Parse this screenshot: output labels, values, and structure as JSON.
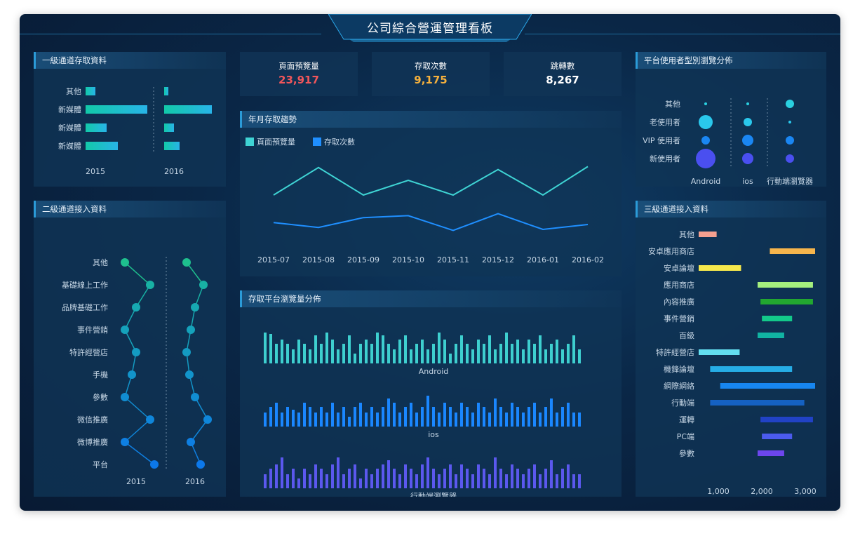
{
  "dashboard": {
    "title": "公司綜合營運管理看板"
  },
  "kpis": [
    {
      "label": "頁面預覽量",
      "value": "23,917",
      "color": "#f0565b"
    },
    {
      "label": "存取次數",
      "value": "9,175",
      "color": "#f6b13d"
    },
    {
      "label": "跳轉數",
      "value": "8,267",
      "color": "#ffffff"
    }
  ],
  "panels": {
    "level1": "一級通道存取資料",
    "level2": "二級通道接入資料",
    "trend": "年月存取趨勢",
    "platform": "存取平台瀏覽量分佈",
    "usertype": "平台使用者型別瀏覽分佈",
    "level3": "三級通道接入資料"
  },
  "chart_data": [
    {
      "type": "bar",
      "orientation": "horizontal",
      "categories": [
        "其他",
        "新媒體",
        "新媒體",
        "新媒體"
      ],
      "series": [
        {
          "name": "2015",
          "values": [
            14,
            88,
            30,
            46
          ]
        },
        {
          "name": "2016",
          "values": [
            6,
            68,
            14,
            22
          ]
        }
      ],
      "panel_labels": [
        "2015",
        "2016"
      ]
    },
    {
      "type": "line",
      "categories": [
        "其他",
        "基礎線上工作",
        "品牌基礎工作",
        "事件營銷",
        "特許經營店",
        "手機",
        "參數",
        "微信推廣",
        "微博推廣",
        "平台"
      ],
      "series": [
        {
          "name": "2015",
          "values": [
            0,
            36,
            16,
            0,
            16,
            10,
            0,
            36,
            0,
            42
          ]
        },
        {
          "name": "2016",
          "values": [
            0,
            24,
            12,
            6,
            0,
            4,
            12,
            30,
            6,
            20
          ]
        }
      ],
      "panel_labels": [
        "2015",
        "2016"
      ]
    },
    {
      "type": "line",
      "x": [
        "2015-07",
        "2015-08",
        "2015-09",
        "2015-10",
        "2015-11",
        "2015-12",
        "2016-01",
        "2016-02"
      ],
      "series": [
        {
          "name": "頁面預覽量",
          "values": [
            70,
            98,
            70,
            85,
            70,
            96,
            70,
            99
          ],
          "color": "#3fd4d4"
        },
        {
          "name": "存取次數",
          "values": [
            42,
            37,
            47,
            49,
            34,
            51,
            35,
            40
          ],
          "color": "#1f8fff"
        }
      ],
      "legend": "top-left"
    },
    {
      "type": "bar",
      "rows": [
        "Android",
        "ios",
        "行動端瀏覽器"
      ],
      "colors": [
        "#3ecfcf",
        "#1a87ff",
        "#5b58ee"
      ],
      "series": [
        {
          "name": "Android",
          "values": [
            44,
            42,
            28,
            34,
            28,
            20,
            34,
            28,
            20,
            40,
            28,
            44,
            34,
            20,
            28,
            40,
            14,
            28,
            34,
            28,
            44,
            40,
            28,
            20,
            34,
            40,
            20,
            28,
            34,
            20,
            28,
            44,
            34,
            14,
            28,
            40,
            28,
            20,
            34,
            28,
            40,
            20,
            28,
            44,
            28,
            34,
            20,
            34,
            28,
            40,
            20,
            28,
            34,
            20,
            28,
            40,
            20
          ]
        },
        {
          "name": "ios",
          "values": [
            20,
            28,
            34,
            20,
            28,
            24,
            20,
            34,
            28,
            20,
            28,
            20,
            34,
            20,
            28,
            14,
            28,
            34,
            20,
            28,
            20,
            28,
            40,
            34,
            20,
            28,
            34,
            20,
            28,
            44,
            28,
            20,
            34,
            28,
            20,
            34,
            28,
            20,
            34,
            28,
            20,
            40,
            28,
            20,
            34,
            28,
            20,
            28,
            34,
            20,
            28,
            40,
            20,
            28,
            34,
            20,
            20
          ]
        },
        {
          "name": "行動端瀏覽器",
          "values": [
            20,
            28,
            34,
            44,
            20,
            28,
            14,
            28,
            20,
            34,
            28,
            20,
            34,
            44,
            20,
            28,
            34,
            14,
            28,
            20,
            28,
            34,
            40,
            28,
            20,
            34,
            28,
            20,
            34,
            44,
            28,
            20,
            28,
            34,
            20,
            34,
            28,
            20,
            34,
            28,
            20,
            44,
            28,
            20,
            34,
            28,
            20,
            28,
            34,
            20,
            28,
            40,
            20,
            28,
            34,
            20,
            20
          ]
        }
      ]
    },
    {
      "type": "scatter",
      "categories": [
        "其他",
        "老使用者",
        "VIP 使用者",
        "新使用者"
      ],
      "x": [
        "Android",
        "ios",
        "行動端瀏覽器"
      ],
      "sizes": [
        [
          2,
          2,
          6
        ],
        [
          10,
          6,
          2
        ],
        [
          6,
          8,
          6
        ],
        [
          14,
          8,
          6
        ]
      ],
      "colors": [
        "#2ad0e0",
        "#1e7fff",
        "#4f50f0"
      ]
    },
    {
      "type": "bar",
      "orientation": "horizontal",
      "categories": [
        "其他",
        "安卓應用商店",
        "安卓論壇",
        "應用商店",
        "內容推廣",
        "事件營銷",
        "百級",
        "特許經營店",
        "機鋒論壇",
        "網際網絡",
        "行動端",
        "運轉",
        "PC端",
        "參數"
      ],
      "ranges": [
        [
          0,
          500
        ],
        [
          1980,
          3240
        ],
        [
          0,
          1180
        ],
        [
          1640,
          3180
        ],
        [
          1720,
          3180
        ],
        [
          1760,
          2600
        ],
        [
          1640,
          2380
        ],
        [
          0,
          1140
        ],
        [
          320,
          2600
        ],
        [
          600,
          3240
        ],
        [
          320,
          2940
        ],
        [
          1720,
          3180
        ],
        [
          1760,
          2600
        ],
        [
          1640,
          2380
        ]
      ],
      "colors": [
        "#f4a090",
        "#f6b54c",
        "#f6e84c",
        "#a5f07e",
        "#22a830",
        "#13c98a",
        "#11b3a2",
        "#63def0",
        "#26ade6",
        "#1786f0",
        "#1561c2",
        "#2142c6",
        "#4b5bee",
        "#6d46ee"
      ],
      "xticks": [
        "1,000",
        "2,000",
        "3,000"
      ]
    }
  ]
}
